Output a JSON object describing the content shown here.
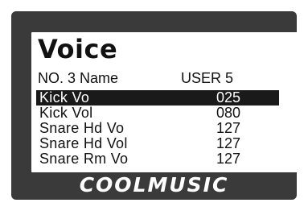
{
  "screen": {
    "title": "Voice",
    "info_label": "NO. 3 Name",
    "info_value": "USER 5"
  },
  "params": [
    {
      "name": "Kick  Vo",
      "value": "025",
      "selected": true
    },
    {
      "name": "Kick  Vol",
      "value": "080",
      "selected": false
    },
    {
      "name": "Snare Hd Vo",
      "value": "127",
      "selected": false
    },
    {
      "name": "Snare Hd Vol",
      "value": "127",
      "selected": false
    },
    {
      "name": "Snare Rm Vo",
      "value": "127",
      "selected": false
    }
  ],
  "brand": "COOLMUSIC",
  "colors": {
    "bezel": "#3a3a3a",
    "screen": "#ffffff",
    "highlight": "#1a1a1a"
  }
}
